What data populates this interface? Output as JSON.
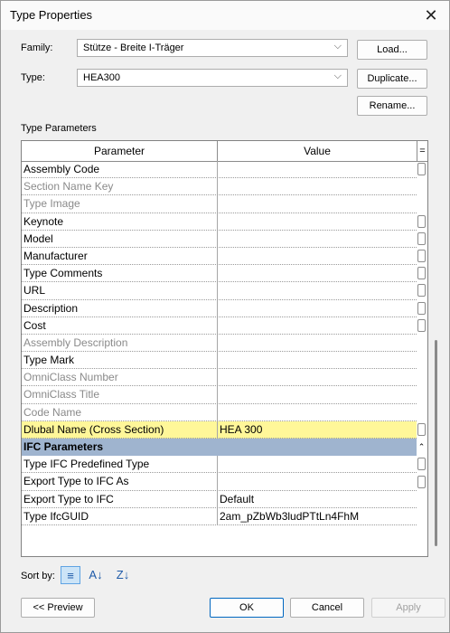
{
  "window": {
    "title": "Type Properties",
    "close_glyph": "✕"
  },
  "family": {
    "label": "Family:",
    "value": "Stütze - Breite I-Träger"
  },
  "type": {
    "label": "Type:",
    "value": "HEA300"
  },
  "buttons": {
    "load": "Load...",
    "duplicate": "Duplicate...",
    "rename": "Rename..."
  },
  "type_parameters": {
    "section_label": "Type Parameters",
    "columns": {
      "parameter": "Parameter",
      "value": "Value",
      "extra": "="
    },
    "rows": [
      {
        "parameter": "Assembly Code",
        "value": "",
        "state": "normal",
        "checkbox": true
      },
      {
        "parameter": "Section Name Key",
        "value": "",
        "state": "disabled",
        "checkbox": false
      },
      {
        "parameter": "Type Image",
        "value": "",
        "state": "disabled",
        "checkbox": false
      },
      {
        "parameter": "Keynote",
        "value": "",
        "state": "normal",
        "checkbox": true
      },
      {
        "parameter": "Model",
        "value": "",
        "state": "normal",
        "checkbox": true
      },
      {
        "parameter": "Manufacturer",
        "value": "",
        "state": "normal",
        "checkbox": true
      },
      {
        "parameter": "Type Comments",
        "value": "",
        "state": "normal",
        "checkbox": true
      },
      {
        "parameter": "URL",
        "value": "",
        "state": "normal",
        "checkbox": true
      },
      {
        "parameter": "Description",
        "value": "",
        "state": "normal",
        "checkbox": true
      },
      {
        "parameter": "Cost",
        "value": "",
        "state": "normal",
        "checkbox": true
      },
      {
        "parameter": "Assembly Description",
        "value": "",
        "state": "disabled",
        "checkbox": false
      },
      {
        "parameter": "Type Mark",
        "value": "",
        "state": "normal",
        "checkbox": false
      },
      {
        "parameter": "OmniClass Number",
        "value": "",
        "state": "disabled",
        "checkbox": false
      },
      {
        "parameter": "OmniClass Title",
        "value": "",
        "state": "disabled",
        "checkbox": false
      },
      {
        "parameter": "Code Name",
        "value": "",
        "state": "disabled",
        "checkbox": false
      },
      {
        "parameter": "Dlubal Name (Cross Section)",
        "value": "HEA 300",
        "state": "highlight",
        "checkbox": true
      },
      {
        "parameter": "IFC Parameters",
        "value": "",
        "state": "group",
        "checkbox": false
      },
      {
        "parameter": "Type IFC Predefined Type",
        "value": "",
        "state": "normal",
        "checkbox": true
      },
      {
        "parameter": "Export Type to IFC As",
        "value": "",
        "state": "normal",
        "checkbox": true
      },
      {
        "parameter": "Export Type to IFC",
        "value": "Default",
        "state": "normal",
        "checkbox": false
      },
      {
        "parameter": "Type IfcGUID",
        "value": "2am_pZbWb3ludPTtLn4FhM",
        "state": "normal",
        "checkbox": false
      }
    ]
  },
  "sort": {
    "label": "Sort by:",
    "icon_category": "≡",
    "icon_az": "A↓",
    "icon_za": "Z↓"
  },
  "footer": {
    "preview": "<< Preview",
    "ok": "OK",
    "cancel": "Cancel",
    "apply": "Apply"
  }
}
